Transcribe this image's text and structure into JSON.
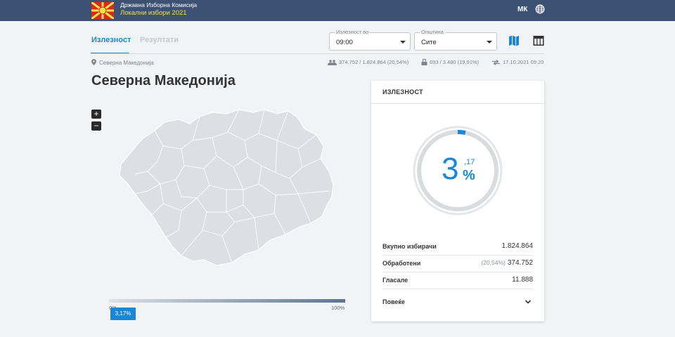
{
  "header": {
    "org_name": "Државна Изборна Комисија",
    "election_name": "Локални избори 2021",
    "language": "МК",
    "colors": {
      "bar": "#3c5173",
      "election_text": "#f7e13c"
    }
  },
  "tabs": [
    {
      "label": "Излезност",
      "active": true
    },
    {
      "label": "Резултати",
      "active": false
    }
  ],
  "filters": {
    "time": {
      "label": "Излезност во",
      "value": "09:00"
    },
    "municipality": {
      "label": "Општина",
      "value": "Сите"
    }
  },
  "view_icons": [
    "map-icon",
    "table-icon"
  ],
  "breadcrumb": "Северна Македонија",
  "stats": {
    "voters": "374.752 / 1.824.864 (20,54%)",
    "stations": "693 / 3.480 (19,91%)",
    "updated": "17.10.2021 09:20"
  },
  "page_title": "Северна Македонија",
  "map": {
    "zoom_in": "+",
    "zoom_out": "−",
    "legend_min": "0%",
    "legend_max": "100%",
    "current_badge": "3,17%"
  },
  "turnout_card": {
    "title": "ИЗЛЕЗНОСТ",
    "value_int": "3",
    "value_dec": ",17",
    "unit": "%",
    "progress_fraction": 0.0317,
    "rows": [
      {
        "label": "Вкупно избирачи",
        "value": "1.824.864",
        "sub": ""
      },
      {
        "label": "Обработени",
        "value": "374.752",
        "sub": "(20,54%)"
      },
      {
        "label": "Гласале",
        "value": "11.888",
        "sub": ""
      }
    ],
    "more_label": "Повеќе"
  },
  "accent_color": "#1a86d6"
}
